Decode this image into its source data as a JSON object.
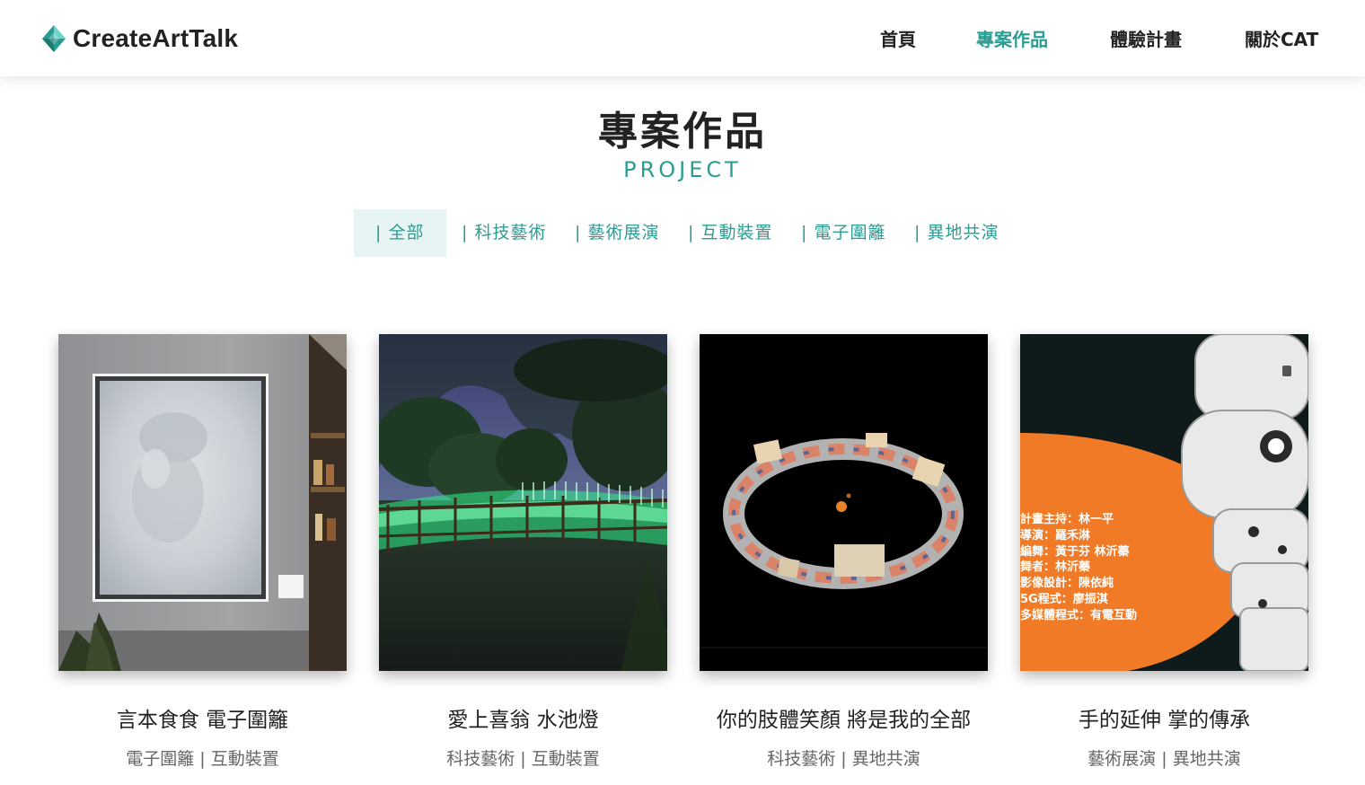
{
  "brand": {
    "name": "CreateArtTalk"
  },
  "nav": {
    "items": [
      {
        "label": "首頁"
      },
      {
        "label": "專案作品"
      },
      {
        "label": "體驗計畫"
      },
      {
        "label": "關於CAT"
      }
    ],
    "active": "專案作品"
  },
  "page": {
    "title": "專案作品",
    "subtitle": "PROJECT"
  },
  "filters": {
    "items": [
      {
        "label": "| 全部"
      },
      {
        "label": "| 科技藝術"
      },
      {
        "label": "| 藝術展演"
      },
      {
        "label": "| 互動裝置"
      },
      {
        "label": "| 電子圍籬"
      },
      {
        "label": "| 異地共演"
      }
    ],
    "active": "| 全部"
  },
  "projects": [
    {
      "title": "言本食食 電子圍籬",
      "tags": "電子圍籬 | 互動裝置",
      "image": "framed koala painting on gallery wall"
    },
    {
      "title": "愛上喜翁 水池燈",
      "tags": "科技藝術 | 互動裝置",
      "image": "green illuminated fence by pond at night"
    },
    {
      "title": "你的肢體笑顏 將是我的全部",
      "tags": "科技藝術 | 異地共演",
      "image": "ring of video panels on black background"
    },
    {
      "title": "手的延伸 掌的傳承",
      "tags": "藝術展演 | 異地共演",
      "image": "robotic arm over orange shape with credits",
      "credits": [
        "計畫主持：林一平",
        "導演：羅禾淋",
        "編舞：黃于芬  林沂蓁",
        "舞者：林沂蓁",
        "影像設計：陳依純",
        "5G程式：廖振淇",
        "多媒體程式：有電互動"
      ]
    }
  ],
  "colors": {
    "accent": "#2a9d92",
    "filter_active_bg": "#e6f4f3",
    "text": "#222222",
    "muted": "#666666"
  }
}
